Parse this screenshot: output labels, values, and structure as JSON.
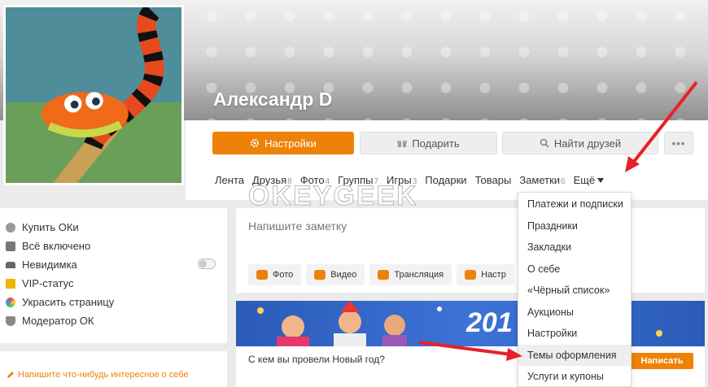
{
  "profile": {
    "name": "Александр D"
  },
  "actions": {
    "settings": "Настройки",
    "gift": "Подарить",
    "find_friends": "Найти друзей",
    "more": "•••"
  },
  "nav": [
    {
      "label": "Лента",
      "count": ""
    },
    {
      "label": "Друзья",
      "count": "8"
    },
    {
      "label": "Фото",
      "count": "4"
    },
    {
      "label": "Группы",
      "count": "7"
    },
    {
      "label": "Игры",
      "count": "3"
    },
    {
      "label": "Подарки",
      "count": ""
    },
    {
      "label": "Товары",
      "count": ""
    },
    {
      "label": "Заметки",
      "count": "6"
    },
    {
      "label": "Ещё",
      "count": ""
    }
  ],
  "watermark": "OKEYGEEK",
  "left_menu": {
    "items": [
      {
        "label": "Купить ОКи",
        "color": "#999"
      },
      {
        "label": "Всё включено",
        "color": "#777"
      },
      {
        "label": "Невидимка",
        "color": "#666"
      },
      {
        "label": "VIP-статус",
        "color": "#f0b400"
      },
      {
        "label": "Украсить страницу",
        "color": "#e44"
      },
      {
        "label": "Модератор ОК",
        "color": "#888"
      }
    ],
    "hint": "Напишите что-нибудь интересное о себе"
  },
  "post": {
    "placeholder": "Напишите заметку",
    "actions": [
      "Фото",
      "Видео",
      "Трансляция",
      "Настр"
    ]
  },
  "banner": {
    "year": "201",
    "question": "С кем вы провели Новый год?",
    "button": "Написать"
  },
  "dropdown": {
    "items": [
      "Платежи и подписки",
      "Праздники",
      "Закладки",
      "О себе",
      "«Чёрный список»",
      "Аукционы",
      "Настройки",
      "Темы оформления",
      "Услуги и купоны"
    ],
    "active_index": 7
  },
  "colors": {
    "accent": "#ee8208",
    "arrow": "#e8202a"
  }
}
